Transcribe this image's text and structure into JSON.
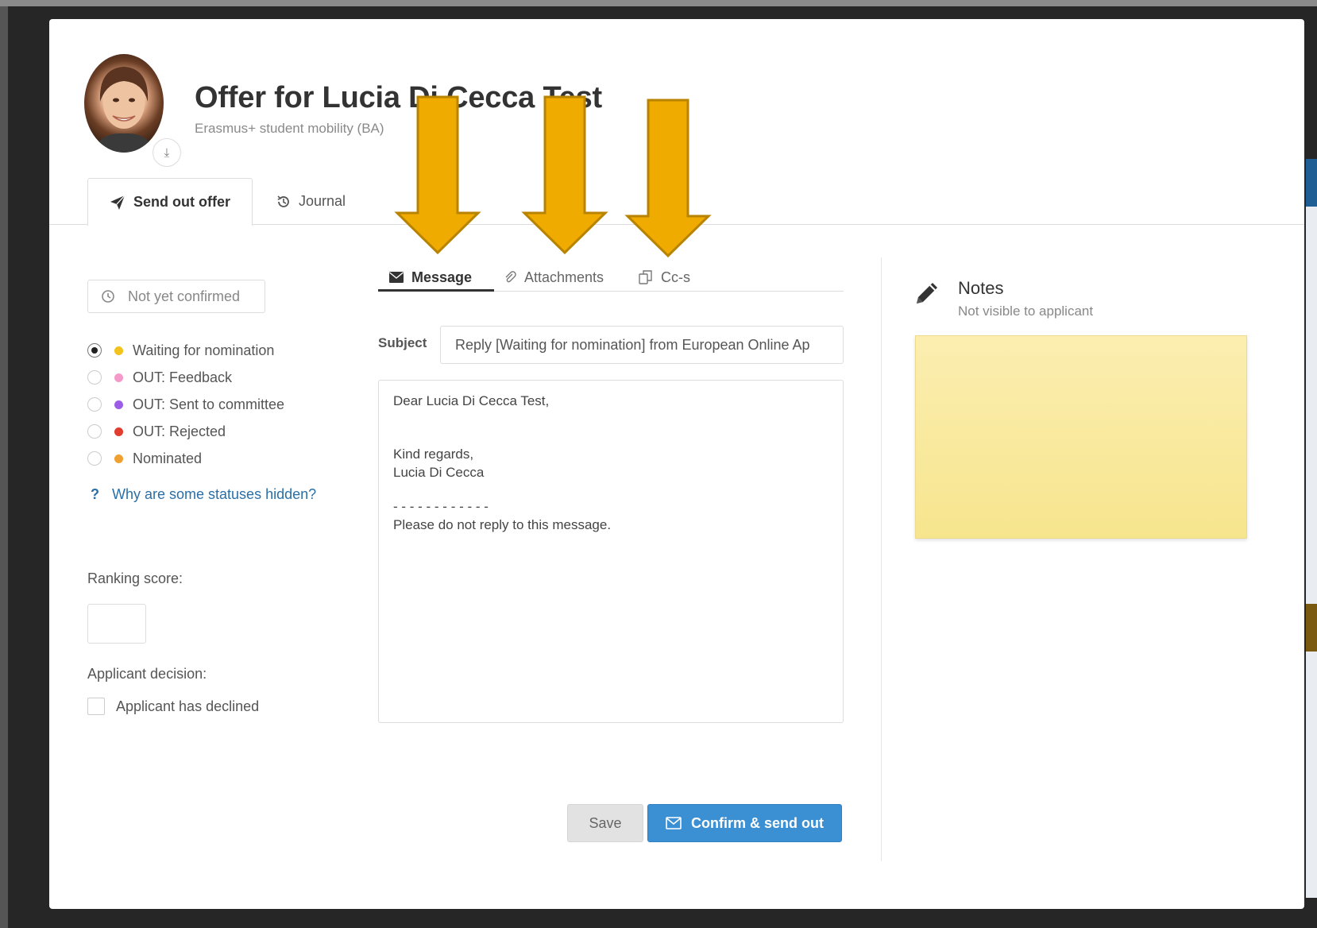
{
  "header": {
    "title": "Offer for Lucia Di Cecca Test",
    "subtitle": "Erasmus+ student mobility (BA)",
    "avatar_badge_icon": "download-icon"
  },
  "tabs": {
    "send_offer": "Send out offer",
    "journal": "Journal"
  },
  "confirmation": {
    "label": "Not yet confirmed",
    "icon": "clock-icon"
  },
  "statuses": [
    {
      "label": "Waiting for nomination",
      "color": "#f2c31c",
      "selected": true
    },
    {
      "label": "OUT: Feedback",
      "color": "#f59ac8",
      "selected": false
    },
    {
      "label": "OUT: Sent to committee",
      "color": "#9b5de5",
      "selected": false
    },
    {
      "label": "OUT: Rejected",
      "color": "#e23c2f",
      "selected": false
    },
    {
      "label": "Nominated",
      "color": "#f0a030",
      "selected": false
    }
  ],
  "help_link": {
    "icon_text": "?",
    "label": "Why are some statuses hidden?"
  },
  "ranking": {
    "label": "Ranking score:",
    "value": ""
  },
  "decision": {
    "label": "Applicant decision:",
    "checkbox_label": "Applicant has declined"
  },
  "message_tabs": {
    "message": "Message",
    "attachments": "Attachments",
    "ccs": "Cc-s"
  },
  "subject": {
    "label": "Subject",
    "value": "Reply [Waiting for nomination] from European Online Ap"
  },
  "message": {
    "greeting": "Dear Lucia Di Cecca Test,",
    "closing": "Kind regards,",
    "sender": "Lucia Di Cecca",
    "separator": "- - - - - - - - - - - -",
    "footer": "Please do not reply to this message."
  },
  "buttons": {
    "save": "Save",
    "confirm": "Confirm & send out"
  },
  "notes": {
    "title": "Notes",
    "subtitle": "Not visible to applicant",
    "note_color": "#f9e9a0"
  },
  "colors": {
    "accent": "#3b8fd3",
    "link": "#2a6fa8",
    "annotation_arrow": "#f0ab00"
  }
}
